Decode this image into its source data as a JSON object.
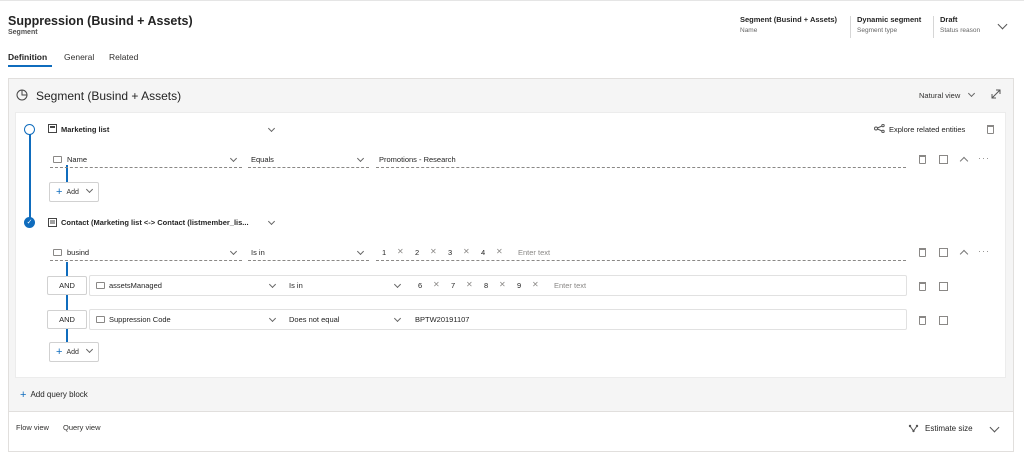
{
  "header": {
    "title": "Suppression (Busind + Assets)",
    "entity": "Segment",
    "fields": [
      {
        "value": "Segment (Busind + Assets)",
        "label": "Name"
      },
      {
        "value": "Dynamic segment",
        "label": "Segment type"
      },
      {
        "value": "Draft",
        "label": "Status reason"
      }
    ]
  },
  "tabs": [
    "Definition",
    "General",
    "Related"
  ],
  "active_tab": "Definition",
  "designer": {
    "title": "Segment (Busind + Assets)",
    "view_selector": "Natural view",
    "block1": {
      "entity": "Marketing list",
      "explore": "Explore related entities",
      "row": {
        "field": "Name",
        "operator": "Equals",
        "value": "Promotions - Research"
      },
      "add_label": "Add"
    },
    "block2": {
      "entity": "Contact (Marketing list <-> Contact (listmember_lis...",
      "row1": {
        "field": "busind",
        "operator": "Is in",
        "values": [
          "1",
          "2",
          "3",
          "4"
        ],
        "placeholder": "Enter text"
      },
      "row2": {
        "logic": "AND",
        "field": "assetsManaged",
        "operator": "Is in",
        "values": [
          "6",
          "7",
          "8",
          "9"
        ],
        "placeholder": "Enter text"
      },
      "row3": {
        "logic": "AND",
        "field": "Suppression Code",
        "operator": "Does not equal",
        "value": "BPTW20191107"
      },
      "add_label": "Add"
    },
    "add_query_block": "Add query block"
  },
  "footer": {
    "views": [
      "Flow view",
      "Query view"
    ],
    "estimate": "Estimate size"
  },
  "colors": {
    "accent": "#0f6cbd",
    "panel_bg": "#f5f5f5"
  }
}
